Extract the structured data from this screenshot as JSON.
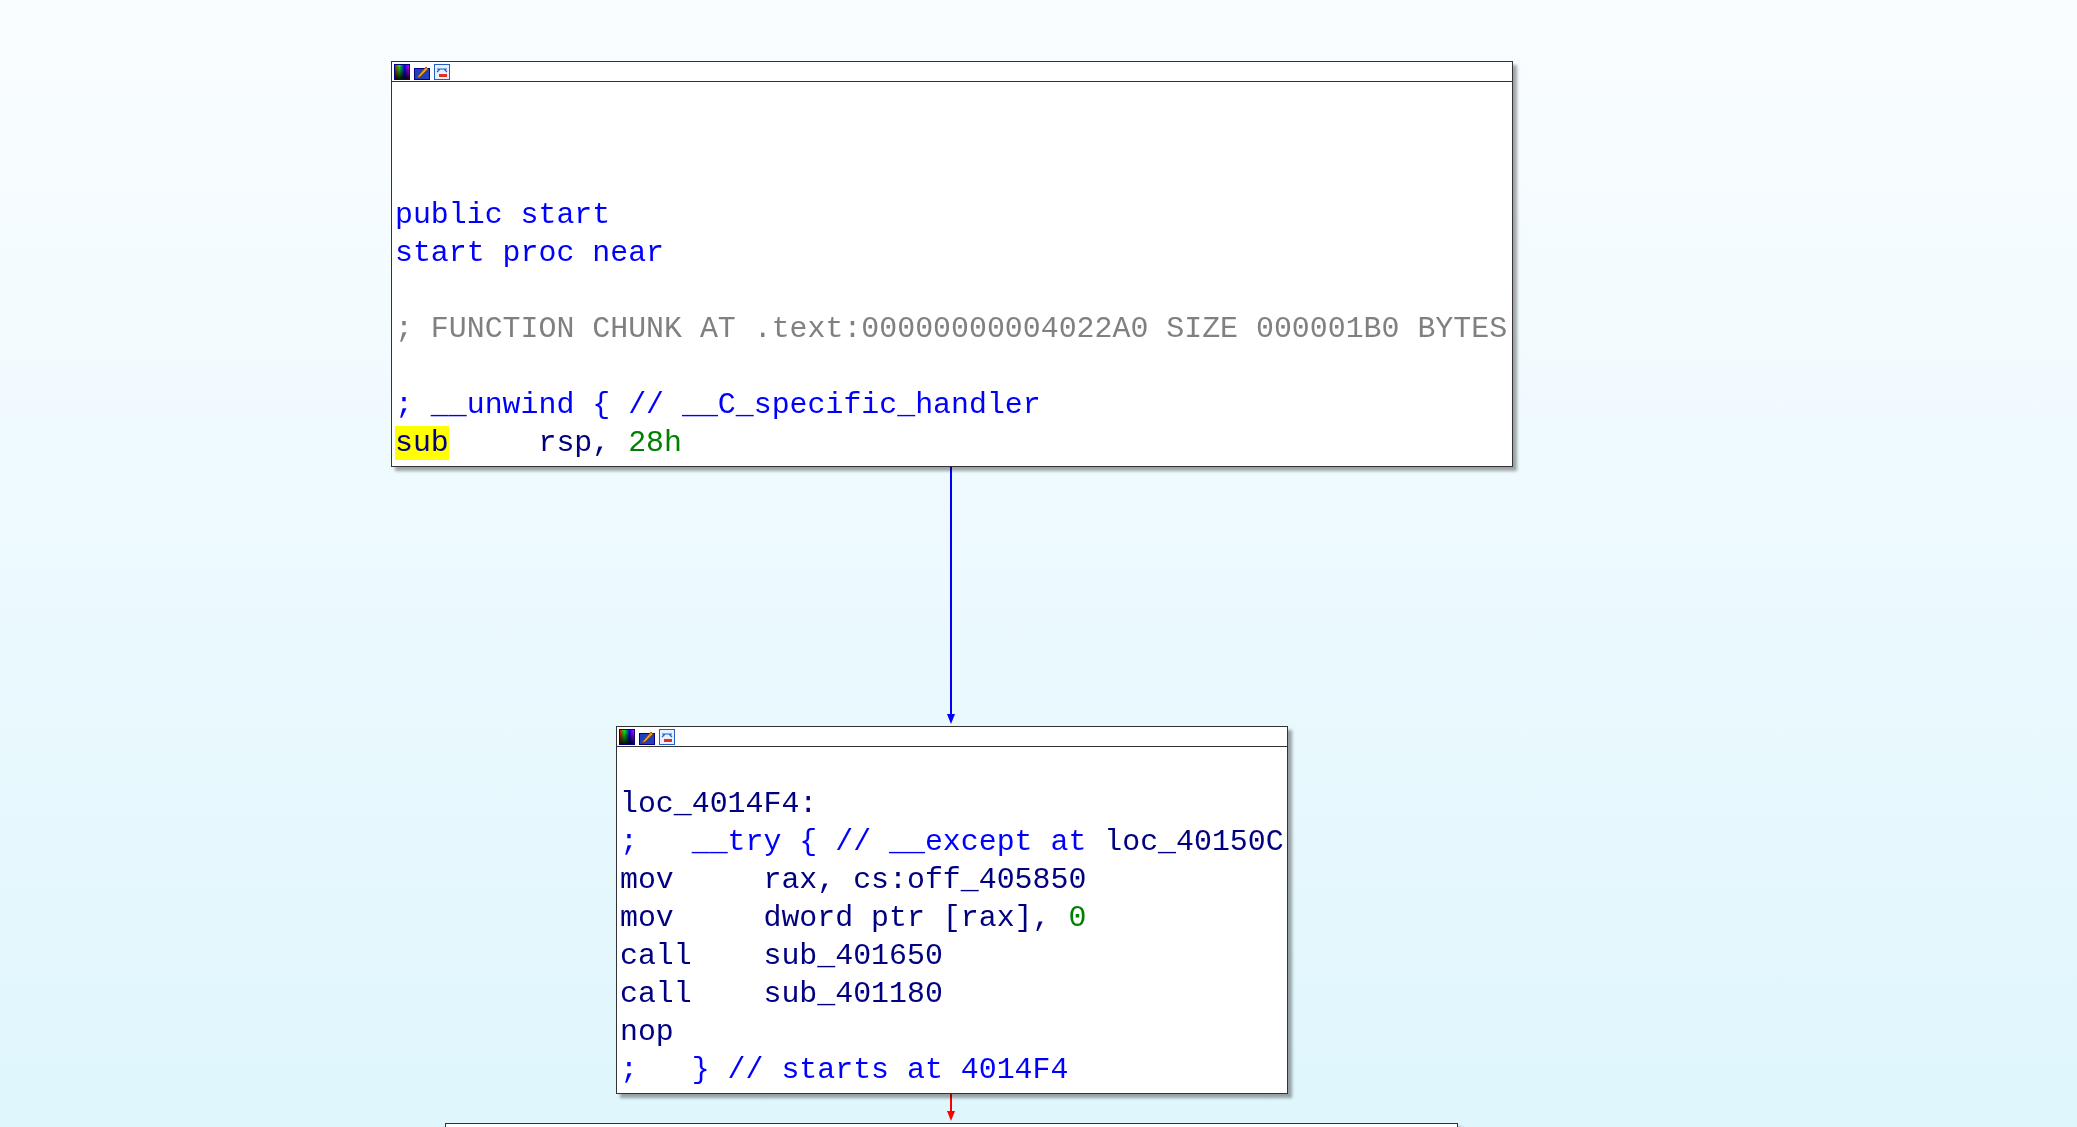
{
  "nodes": [
    {
      "lines": [
        {
          "kind": "blank"
        },
        {
          "kind": "blank"
        },
        {
          "kind": "blank"
        },
        {
          "kind": "text",
          "segments": [
            {
              "text": "public start",
              "kind": "directive"
            }
          ]
        },
        {
          "kind": "text",
          "segments": [
            {
              "text": "start proc near",
              "kind": "directive"
            }
          ]
        },
        {
          "kind": "blank"
        },
        {
          "kind": "text",
          "segments": [
            {
              "text": "; FUNCTION CHUNK AT .text:00000000004022A0 SIZE 000001B0 BYTES",
              "kind": "gray"
            }
          ]
        },
        {
          "kind": "blank"
        },
        {
          "kind": "text",
          "segments": [
            {
              "text": "; __unwind { // __C_specific_handler",
              "kind": "directive"
            }
          ]
        },
        {
          "kind": "code",
          "mnemonic": "sub",
          "highlighted": true,
          "segments": [
            {
              "text": "rsp, ",
              "kind": "name"
            },
            {
              "text": "28h",
              "kind": "number"
            }
          ]
        }
      ]
    },
    {
      "lines": [
        {
          "kind": "blank"
        },
        {
          "kind": "text",
          "segments": [
            {
              "text": "loc_4014F4:",
              "kind": "name"
            }
          ]
        },
        {
          "kind": "text",
          "segments": [
            {
              "text": ";   __try { // __except at ",
              "kind": "directive"
            },
            {
              "text": "loc_40150C",
              "kind": "name"
            }
          ]
        },
        {
          "kind": "code",
          "mnemonic": "mov",
          "highlighted": false,
          "segments": [
            {
              "text": "rax, cs:off_405850",
              "kind": "name"
            }
          ]
        },
        {
          "kind": "code",
          "mnemonic": "mov",
          "highlighted": false,
          "segments": [
            {
              "text": "dword ptr [rax], ",
              "kind": "name"
            },
            {
              "text": "0",
              "kind": "number"
            }
          ]
        },
        {
          "kind": "code",
          "mnemonic": "call",
          "highlighted": false,
          "segments": [
            {
              "text": "sub_401650",
              "kind": "name"
            }
          ]
        },
        {
          "kind": "code",
          "mnemonic": "call",
          "highlighted": false,
          "segments": [
            {
              "text": "sub_401180",
              "kind": "name"
            }
          ]
        },
        {
          "kind": "code",
          "mnemonic": "nop",
          "highlighted": false
        },
        {
          "kind": "text",
          "segments": [
            {
              "text": ";   } // starts at 4014F4",
              "kind": "directive"
            }
          ]
        }
      ]
    }
  ],
  "edges": [
    {
      "color": "#0000ff"
    },
    {
      "color": "#ff0000"
    }
  ]
}
